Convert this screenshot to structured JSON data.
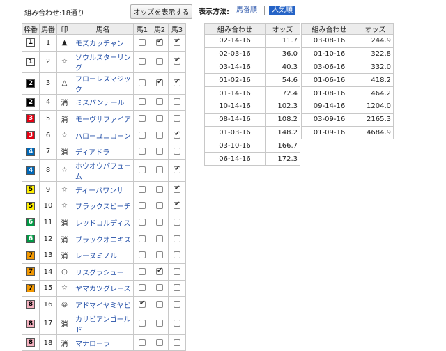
{
  "header": {
    "combo_count": "組み合わせ:18通り",
    "show_odds_button": "オッズを表示する",
    "display_method_label": "表示方法:",
    "sort_options": [
      {
        "label": "馬番順",
        "active": false
      },
      {
        "label": "人気順",
        "active": true
      }
    ]
  },
  "horse_table": {
    "headers": [
      "枠番",
      "馬番",
      "印",
      "馬名",
      "馬1",
      "馬2",
      "馬3"
    ],
    "waku_colors": {
      "1": {
        "bg": "#ffffff",
        "fg": "#000000"
      },
      "2": {
        "bg": "#000000",
        "fg": "#ffffff"
      },
      "3": {
        "bg": "#e60012",
        "fg": "#ffffff"
      },
      "4": {
        "bg": "#0068b7",
        "fg": "#ffffff"
      },
      "5": {
        "bg": "#ffef00",
        "fg": "#000000"
      },
      "6": {
        "bg": "#009944",
        "fg": "#ffffff"
      },
      "7": {
        "bg": "#f39800",
        "fg": "#000000"
      },
      "8": {
        "bg": "#f5b2c0",
        "fg": "#000000"
      }
    },
    "rows": [
      {
        "waku": "1",
        "uma": "1",
        "mark": "▲",
        "name": "モズカッチャン",
        "c1": false,
        "c2": true,
        "c3": true
      },
      {
        "waku": "1",
        "uma": "2",
        "mark": "☆",
        "name": "ソウルスターリング",
        "c1": false,
        "c2": false,
        "c3": true
      },
      {
        "waku": "2",
        "uma": "3",
        "mark": "△",
        "name": "フローレスマジック",
        "c1": false,
        "c2": true,
        "c3": true
      },
      {
        "waku": "2",
        "uma": "4",
        "mark": "消",
        "name": "ミスパンテール",
        "c1": false,
        "c2": false,
        "c3": false
      },
      {
        "waku": "3",
        "uma": "5",
        "mark": "消",
        "name": "モーヴサファイア",
        "c1": false,
        "c2": false,
        "c3": false
      },
      {
        "waku": "3",
        "uma": "6",
        "mark": "☆",
        "name": "ハローユニコーン",
        "c1": false,
        "c2": false,
        "c3": true
      },
      {
        "waku": "4",
        "uma": "7",
        "mark": "消",
        "name": "ディアドラ",
        "c1": false,
        "c2": false,
        "c3": false
      },
      {
        "waku": "4",
        "uma": "8",
        "mark": "☆",
        "name": "ホウオウパフューム",
        "c1": false,
        "c2": false,
        "c3": true
      },
      {
        "waku": "5",
        "uma": "9",
        "mark": "☆",
        "name": "ディーパワンサ",
        "c1": false,
        "c2": false,
        "c3": true
      },
      {
        "waku": "5",
        "uma": "10",
        "mark": "☆",
        "name": "ブラックスビーチ",
        "c1": false,
        "c2": false,
        "c3": true
      },
      {
        "waku": "6",
        "uma": "11",
        "mark": "消",
        "name": "レッドコルディス",
        "c1": false,
        "c2": false,
        "c3": false
      },
      {
        "waku": "6",
        "uma": "12",
        "mark": "消",
        "name": "ブラックオニキス",
        "c1": false,
        "c2": false,
        "c3": false
      },
      {
        "waku": "7",
        "uma": "13",
        "mark": "消",
        "name": "レーヌミノル",
        "c1": false,
        "c2": false,
        "c3": false
      },
      {
        "waku": "7",
        "uma": "14",
        "mark": "○",
        "name": "リスグラシュー",
        "c1": false,
        "c2": true,
        "c3": false
      },
      {
        "waku": "7",
        "uma": "15",
        "mark": "☆",
        "name": "ヤマカツグレース",
        "c1": false,
        "c2": false,
        "c3": false
      },
      {
        "waku": "8",
        "uma": "16",
        "mark": "◎",
        "name": "アドマイヤミヤビ",
        "c1": true,
        "c2": false,
        "c3": false
      },
      {
        "waku": "8",
        "uma": "17",
        "mark": "消",
        "name": "カリビアンゴールド",
        "c1": false,
        "c2": false,
        "c3": false
      },
      {
        "waku": "8",
        "uma": "18",
        "mark": "消",
        "name": "マナローラ",
        "c1": false,
        "c2": false,
        "c3": false
      }
    ]
  },
  "odds_tables": [
    {
      "headers": [
        "組み合わせ",
        "オッズ"
      ],
      "rows": [
        {
          "combo": "02-14-16",
          "odds": "11.7"
        },
        {
          "combo": "02-03-16",
          "odds": "36.0"
        },
        {
          "combo": "03-14-16",
          "odds": "40.3"
        },
        {
          "combo": "01-02-16",
          "odds": "54.6"
        },
        {
          "combo": "01-14-16",
          "odds": "72.4"
        },
        {
          "combo": "10-14-16",
          "odds": "102.3"
        },
        {
          "combo": "08-14-16",
          "odds": "108.2"
        },
        {
          "combo": "01-03-16",
          "odds": "148.2"
        },
        {
          "combo": "03-10-16",
          "odds": "166.7"
        },
        {
          "combo": "06-14-16",
          "odds": "172.3"
        }
      ]
    },
    {
      "headers": [
        "組み合わせ",
        "オッズ"
      ],
      "rows": [
        {
          "combo": "03-08-16",
          "odds": "244.9"
        },
        {
          "combo": "01-10-16",
          "odds": "322.8"
        },
        {
          "combo": "03-06-16",
          "odds": "332.0"
        },
        {
          "combo": "01-06-16",
          "odds": "418.2"
        },
        {
          "combo": "01-08-16",
          "odds": "464.2"
        },
        {
          "combo": "09-14-16",
          "odds": "1204.0"
        },
        {
          "combo": "03-09-16",
          "odds": "2165.3"
        },
        {
          "combo": "01-09-16",
          "odds": "4684.9"
        }
      ]
    }
  ]
}
